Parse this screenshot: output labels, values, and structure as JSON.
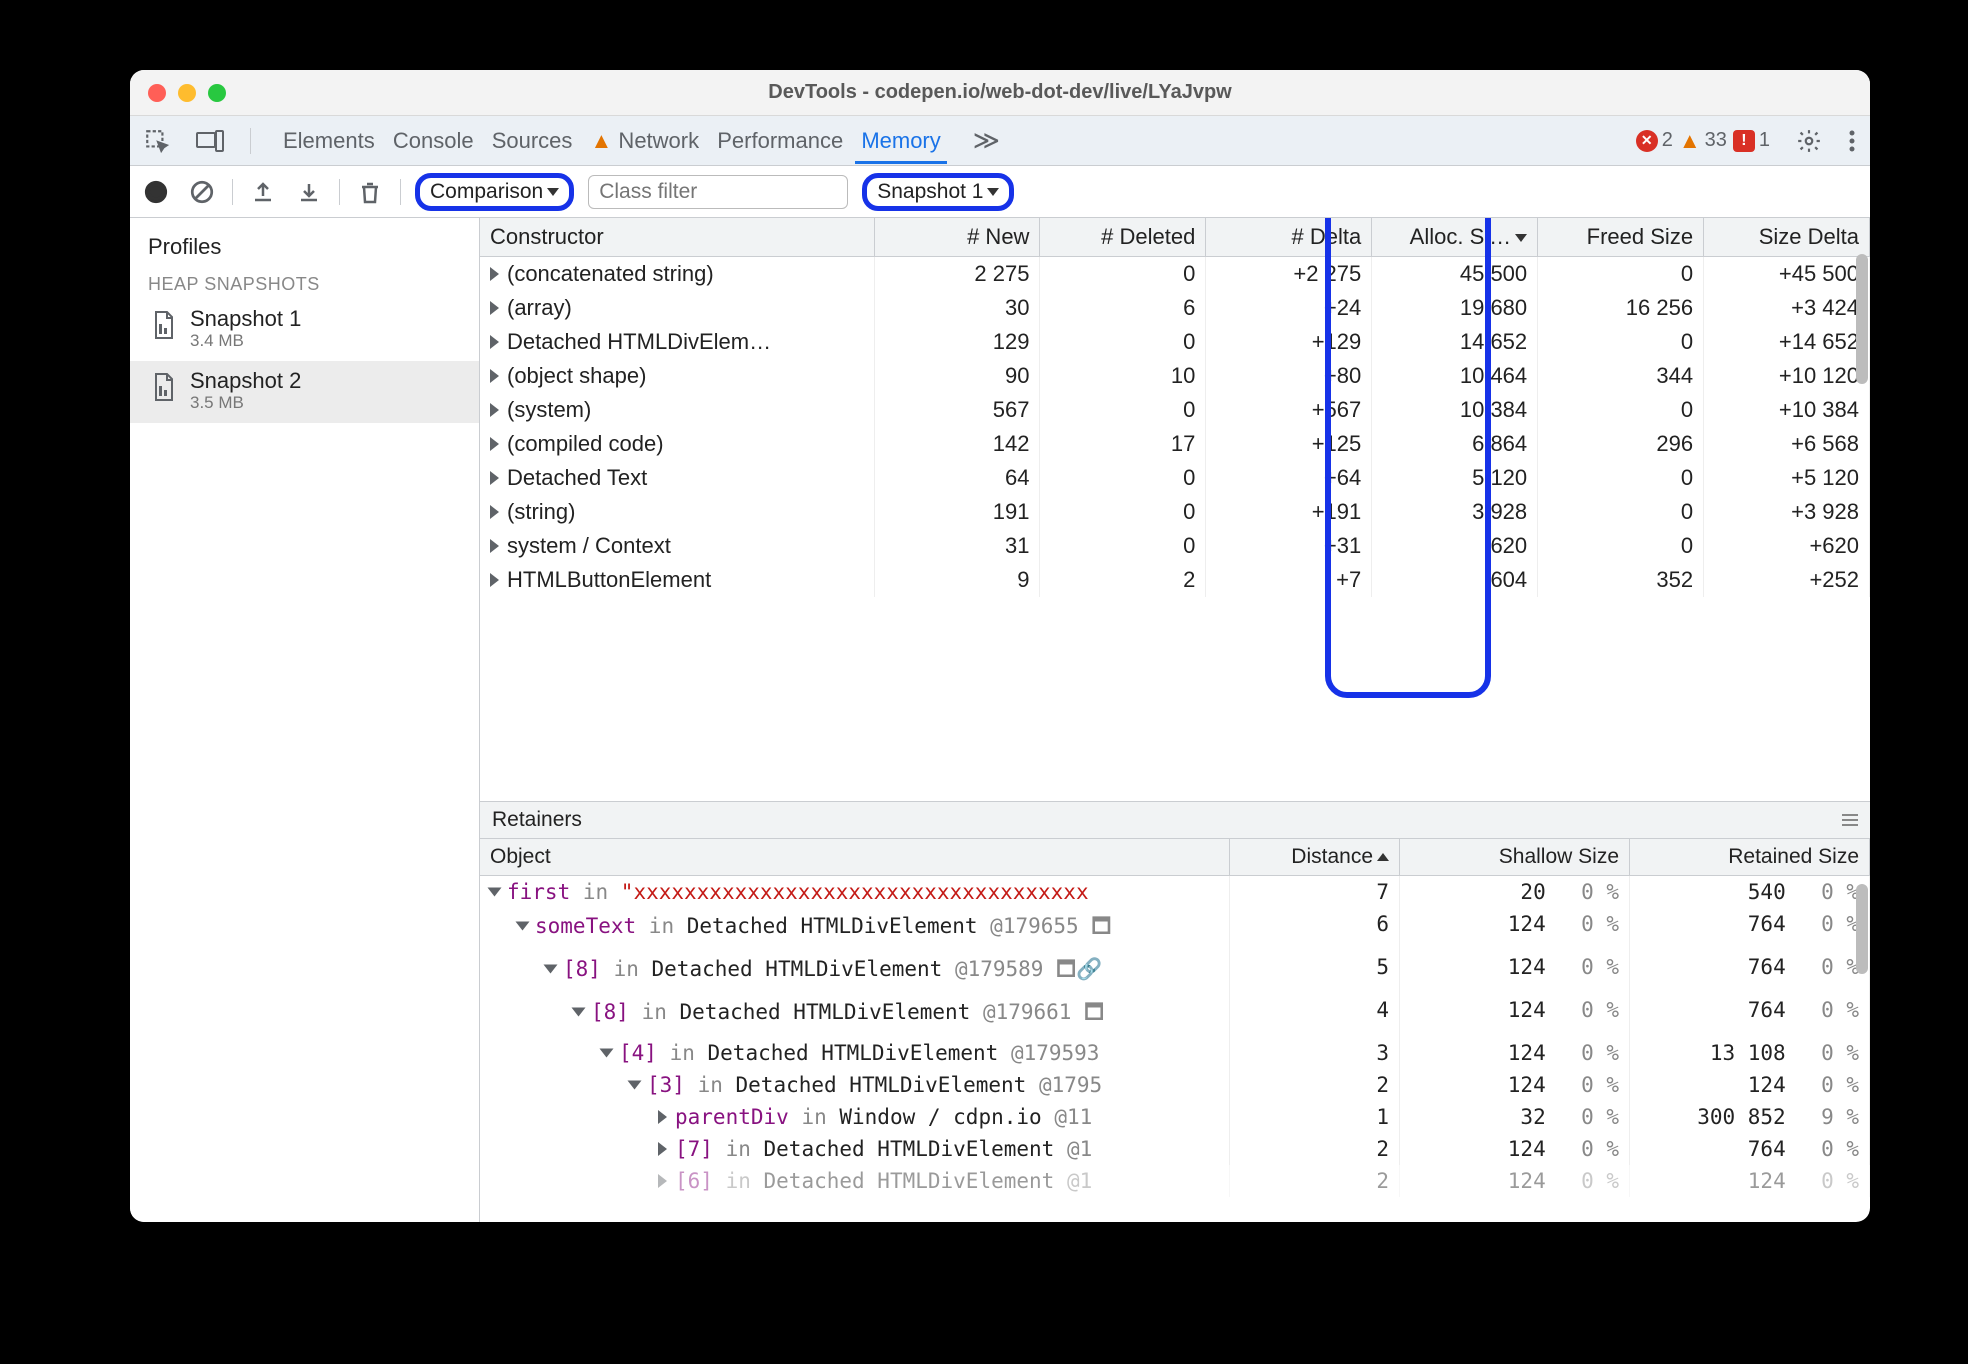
{
  "window_title": "DevTools - codepen.io/web-dot-dev/live/LYaJvpw",
  "tabs": [
    "Elements",
    "Console",
    "Sources",
    "Network",
    "Performance",
    "Memory"
  ],
  "active_tab": "Memory",
  "network_warning": true,
  "more_tabs_glyph": "≫",
  "status": {
    "errors": 2,
    "warnings": 33,
    "issues": 1
  },
  "toolbar": {
    "view_mode": "Comparison",
    "class_filter_placeholder": "Class filter",
    "compare_to": "Snapshot 1"
  },
  "sidebar": {
    "profiles_label": "Profiles",
    "section_label": "HEAP SNAPSHOTS",
    "snapshots": [
      {
        "name": "Snapshot 1",
        "size": "3.4 MB",
        "active": false
      },
      {
        "name": "Snapshot 2",
        "size": "3.5 MB",
        "active": true
      }
    ]
  },
  "comparison_table": {
    "columns": [
      "Constructor",
      "# New",
      "# Deleted",
      "# Delta",
      "Alloc. Si…",
      "Freed Size",
      "Size Delta"
    ],
    "sort_column_index": 4,
    "sort_dir": "desc",
    "rows": [
      {
        "c": "(concatenated string)",
        "new": "2 275",
        "del": "0",
        "delta": "+2 275",
        "alloc": "45 500",
        "freed": "0",
        "sdelta": "+45 500"
      },
      {
        "c": "(array)",
        "new": "30",
        "del": "6",
        "delta": "+24",
        "alloc": "19 680",
        "freed": "16 256",
        "sdelta": "+3 424"
      },
      {
        "c": "Detached HTMLDivElem…",
        "new": "129",
        "del": "0",
        "delta": "+129",
        "alloc": "14 652",
        "freed": "0",
        "sdelta": "+14 652"
      },
      {
        "c": "(object shape)",
        "new": "90",
        "del": "10",
        "delta": "+80",
        "alloc": "10 464",
        "freed": "344",
        "sdelta": "+10 120"
      },
      {
        "c": "(system)",
        "new": "567",
        "del": "0",
        "delta": "+567",
        "alloc": "10 384",
        "freed": "0",
        "sdelta": "+10 384"
      },
      {
        "c": "(compiled code)",
        "new": "142",
        "del": "17",
        "delta": "+125",
        "alloc": "6 864",
        "freed": "296",
        "sdelta": "+6 568"
      },
      {
        "c": "Detached Text",
        "new": "64",
        "del": "0",
        "delta": "+64",
        "alloc": "5 120",
        "freed": "0",
        "sdelta": "+5 120"
      },
      {
        "c": "(string)",
        "new": "191",
        "del": "0",
        "delta": "+191",
        "alloc": "3 928",
        "freed": "0",
        "sdelta": "+3 928"
      },
      {
        "c": "system / Context",
        "new": "31",
        "del": "0",
        "delta": "+31",
        "alloc": "620",
        "freed": "0",
        "sdelta": "+620"
      },
      {
        "c": "HTMLButtonElement",
        "new": "9",
        "del": "2",
        "delta": "+7",
        "alloc": "604",
        "freed": "352",
        "sdelta": "+252"
      }
    ]
  },
  "retainers": {
    "header": "Retainers",
    "columns": [
      "Object",
      "Distance",
      "Shallow Size",
      "Retained Size"
    ],
    "sort_column_index": 1,
    "sort_dir": "asc",
    "rows": [
      {
        "indent": 0,
        "open": true,
        "prop": "first",
        "in": " in ",
        "str": "\"xxxxxxxxxxxxxxxxxxxxxxxxxxxxxxxxxxxx",
        "dist": "7",
        "shallow": "20",
        "shp": "0 %",
        "ret": "540",
        "retp": "0 %"
      },
      {
        "indent": 1,
        "open": true,
        "prop": "someText",
        "in": " in ",
        "rest": "Detached HTMLDivElement ",
        "id": "@179655 🗖",
        "dist": "6",
        "shallow": "124",
        "shp": "0 %",
        "ret": "764",
        "retp": "0 %"
      },
      {
        "indent": 2,
        "open": true,
        "prop": "[8]",
        "in": " in ",
        "rest": "Detached HTMLDivElement ",
        "id": "@179589 🗖🔗",
        "dist": "5",
        "shallow": "124",
        "shp": "0 %",
        "ret": "764",
        "retp": "0 %"
      },
      {
        "indent": 3,
        "open": true,
        "prop": "[8]",
        "in": " in ",
        "rest": "Detached HTMLDivElement ",
        "id": "@179661 🗖",
        "dist": "4",
        "shallow": "124",
        "shp": "0 %",
        "ret": "764",
        "retp": "0 %"
      },
      {
        "indent": 4,
        "open": true,
        "prop": "[4]",
        "in": " in ",
        "rest": "Detached HTMLDivElement ",
        "id": "@179593",
        "dist": "3",
        "shallow": "124",
        "shp": "0 %",
        "ret": "13 108",
        "retp": "0 %"
      },
      {
        "indent": 5,
        "open": true,
        "prop": "[3]",
        "in": " in ",
        "rest": "Detached HTMLDivElement ",
        "id": "@1795",
        "dist": "2",
        "shallow": "124",
        "shp": "0 %",
        "ret": "124",
        "retp": "0 %"
      },
      {
        "indent": 6,
        "open": false,
        "prop": "parentDiv",
        "in": " in ",
        "rest": "Window / cdpn.io ",
        "id": "@11",
        "dist": "1",
        "shallow": "32",
        "shp": "0 %",
        "ret": "300 852",
        "retp": "9 %"
      },
      {
        "indent": 6,
        "open": false,
        "prop": "[7]",
        "in": " in ",
        "rest": "Detached HTMLDivElement ",
        "id": "@1",
        "dist": "2",
        "shallow": "124",
        "shp": "0 %",
        "ret": "764",
        "retp": "0 %"
      },
      {
        "indent": 6,
        "open": false,
        "faded": true,
        "prop": "[6]",
        "in": " in ",
        "rest": "Detached HTMLDivElement ",
        "id": "@1",
        "dist": "2",
        "shallow": "124",
        "shp": "0 %",
        "ret": "124",
        "retp": "0 %"
      }
    ]
  }
}
